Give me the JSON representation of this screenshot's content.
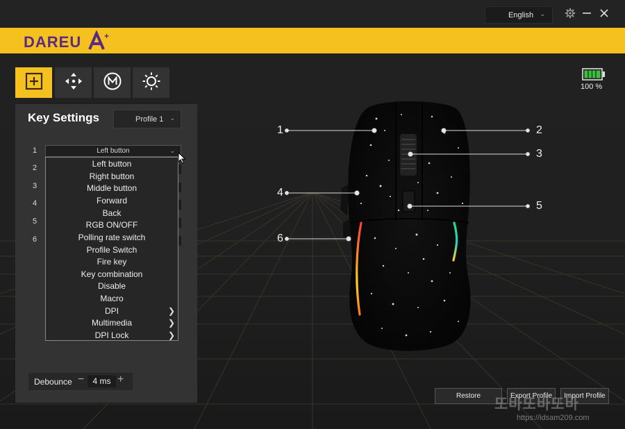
{
  "window": {
    "language": "English",
    "icons": [
      "gear-icon",
      "minimize-icon",
      "close-icon"
    ]
  },
  "brand": {
    "logo_text": "DAREU",
    "accent": "#f5c11f"
  },
  "toolbar": {
    "tabs": [
      {
        "icon": "plus-square-icon",
        "active": true
      },
      {
        "icon": "move-arrows-icon",
        "active": false
      },
      {
        "icon": "macro-m-icon",
        "active": false
      },
      {
        "icon": "light-sun-icon",
        "active": false
      }
    ]
  },
  "battery": {
    "percent_label": "100 %",
    "level": 1.0,
    "color": "#38c23a"
  },
  "panel": {
    "title": "Key Settings",
    "profile": "Profile 1",
    "key_numbers": [
      "1",
      "2",
      "3",
      "4",
      "5",
      "6"
    ],
    "key1_value": "Left button"
  },
  "dropdown": {
    "options": [
      {
        "label": "Left button",
        "submenu": false
      },
      {
        "label": "Right button",
        "submenu": false
      },
      {
        "label": "Middle button",
        "submenu": false
      },
      {
        "label": "Forward",
        "submenu": false
      },
      {
        "label": "Back",
        "submenu": false
      },
      {
        "label": "RGB ON/OFF",
        "submenu": false
      },
      {
        "label": "Polling rate switch",
        "submenu": false
      },
      {
        "label": "Profile Switch",
        "submenu": false
      },
      {
        "label": "Fire key",
        "submenu": false
      },
      {
        "label": "Key combination",
        "submenu": false
      },
      {
        "label": "Disable",
        "submenu": false
      },
      {
        "label": "Macro",
        "submenu": false
      },
      {
        "label": "DPI",
        "submenu": true
      },
      {
        "label": "Multimedia",
        "submenu": true
      },
      {
        "label": "DPI Lock",
        "submenu": true
      }
    ]
  },
  "debounce": {
    "label": "Debounce",
    "value": "4 ms"
  },
  "callouts": [
    "1",
    "2",
    "3",
    "4",
    "5",
    "6"
  ],
  "buttons": {
    "restore": "Restore",
    "export": "Export Profile",
    "import": "Import Profile"
  },
  "watermark": {
    "text": "또바또바또바",
    "url": "https://idsam209.com"
  }
}
